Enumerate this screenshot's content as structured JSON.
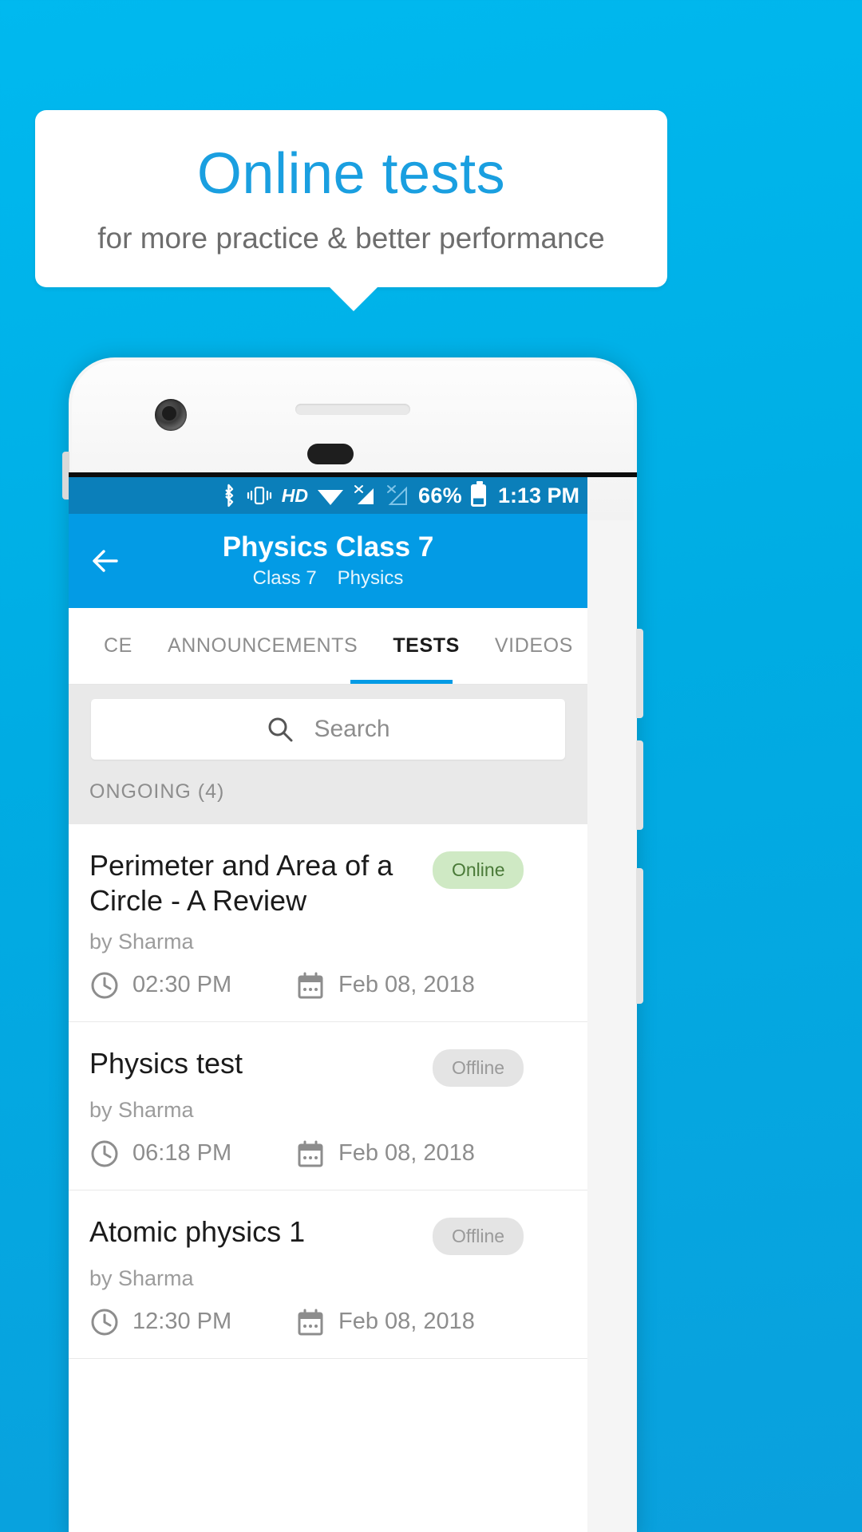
{
  "promo": {
    "title": "Online tests",
    "subtitle": "for more practice & better performance",
    "title_color": "#1a9fe0",
    "background_color": "#00b0e8"
  },
  "status_bar": {
    "icons": [
      "bluetooth-icon",
      "vibrate-icon",
      "hd-icon",
      "wifi-icon",
      "signal-no-sim-icon",
      "signal-empty-icon"
    ],
    "hd_label": "HD",
    "battery_percent": "66%",
    "time": "1:13 PM"
  },
  "app_bar": {
    "back_label": "back-arrow",
    "title": "Physics Class 7",
    "subtitle_class": "Class 7",
    "subtitle_subject": "Physics",
    "color": "#039be5"
  },
  "tabs": [
    {
      "label": "CE",
      "active": false
    },
    {
      "label": "ANNOUNCEMENTS",
      "active": false
    },
    {
      "label": "TESTS",
      "active": true
    },
    {
      "label": "VIDEOS",
      "active": false
    }
  ],
  "search": {
    "placeholder": "Search",
    "value": ""
  },
  "section": {
    "label": "ONGOING (4)"
  },
  "tests": [
    {
      "title": "Perimeter and Area of a Circle - A Review",
      "author": "by Sharma",
      "status": "Online",
      "status_kind": "online",
      "time": "02:30 PM",
      "date": "Feb 08, 2018"
    },
    {
      "title": "Physics test",
      "author": "by Sharma",
      "status": "Offline",
      "status_kind": "offline",
      "time": "06:18 PM",
      "date": "Feb 08, 2018"
    },
    {
      "title": "Atomic physics 1",
      "author": "by Sharma",
      "status": "Offline",
      "status_kind": "offline",
      "time": "12:30 PM",
      "date": "Feb 08, 2018"
    }
  ]
}
